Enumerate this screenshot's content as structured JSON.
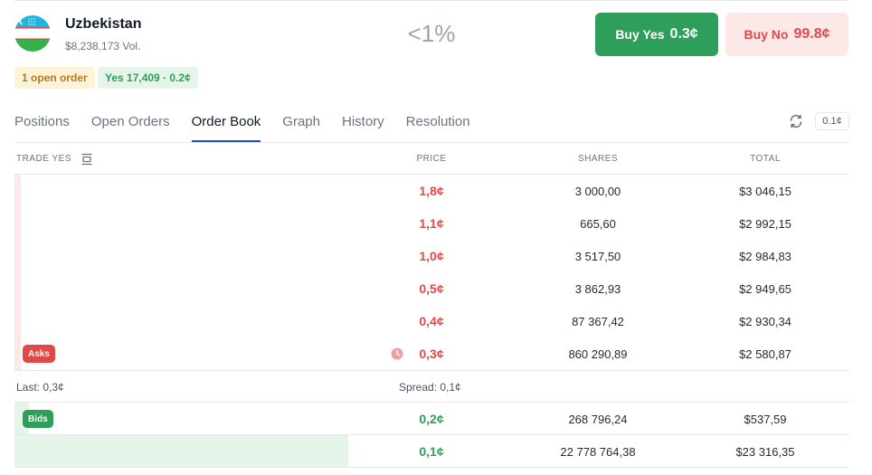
{
  "market": {
    "name": "Uzbekistan",
    "volume": "$8,238,173 Vol.",
    "chance": "<1%",
    "flag_colors": {
      "top": "#1eb5e0",
      "middle": "#ffffff",
      "stripe": "#e0494a",
      "bottom": "#35b04a"
    }
  },
  "actions": {
    "buy_yes_label": "Buy Yes",
    "buy_yes_price": "0.3¢",
    "buy_no_label": "Buy No",
    "buy_no_price": "99.8¢"
  },
  "chips": {
    "open_orders": "1 open order",
    "position": "Yes 17,409 · 0.2¢"
  },
  "tabs": [
    {
      "label": "Positions"
    },
    {
      "label": "Open Orders"
    },
    {
      "label": "Order Book",
      "active": true
    },
    {
      "label": "Graph"
    },
    {
      "label": "History"
    },
    {
      "label": "Resolution"
    }
  ],
  "tick_size": "0.1¢",
  "table": {
    "headers": {
      "trade": "TRADE YES",
      "price": "PRICE",
      "shares": "SHARES",
      "total": "TOTAL"
    },
    "asks_label": "Asks",
    "bids_label": "Bids",
    "asks": [
      {
        "price": "1,8¢",
        "shares": "3 000,00",
        "total": "$3 046,15",
        "depth": 0.0
      },
      {
        "price": "1,1¢",
        "shares": "665,60",
        "total": "$2 992,15",
        "depth": 0.0
      },
      {
        "price": "1,0¢",
        "shares": "3 517,50",
        "total": "$2 984,83",
        "depth": 0.0
      },
      {
        "price": "0,5¢",
        "shares": "3 862,93",
        "total": "$2 949,65",
        "depth": 0.0
      },
      {
        "price": "0,4¢",
        "shares": "87 367,42",
        "total": "$2 930,34",
        "depth": 0.0
      },
      {
        "price": "0,3¢",
        "shares": "860 290,89",
        "total": "$2 580,87",
        "depth": 0.0
      }
    ],
    "last": "Last: 0,3¢",
    "spread": "Spread: 0,1¢",
    "bids": [
      {
        "price": "0,2¢",
        "shares": "268 796,24",
        "total": "$537,59",
        "depth": 0.017
      },
      {
        "price": "0,1¢",
        "shares": "22 778 764,38",
        "total": "$23 316,35",
        "depth": 0.4
      }
    ],
    "colors": {
      "ask": "#e0494a",
      "bid": "#2f9e5b",
      "ask_bg": "#fde8e8",
      "bid_bg": "#e6f5ea"
    }
  }
}
